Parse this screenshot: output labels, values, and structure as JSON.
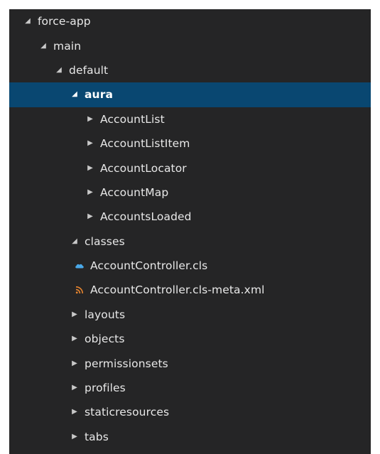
{
  "explorer": {
    "items": [
      {
        "label": "force-app",
        "type": "folder",
        "expanded": true,
        "depth": 0
      },
      {
        "label": "main",
        "type": "folder",
        "expanded": true,
        "depth": 1
      },
      {
        "label": "default",
        "type": "folder",
        "expanded": true,
        "depth": 2
      },
      {
        "label": "aura",
        "type": "folder",
        "expanded": true,
        "depth": 3,
        "selected": true
      },
      {
        "label": "AccountList",
        "type": "folder",
        "expanded": false,
        "depth": 4
      },
      {
        "label": "AccountListItem",
        "type": "folder",
        "expanded": false,
        "depth": 4
      },
      {
        "label": "AccountLocator",
        "type": "folder",
        "expanded": false,
        "depth": 4
      },
      {
        "label": "AccountMap",
        "type": "folder",
        "expanded": false,
        "depth": 4
      },
      {
        "label": "AccountsLoaded",
        "type": "folder",
        "expanded": false,
        "depth": 4
      },
      {
        "label": "classes",
        "type": "folder",
        "expanded": true,
        "depth": 3
      },
      {
        "label": "AccountController.cls",
        "type": "file",
        "icon": "cls-file-icon",
        "depth": 4
      },
      {
        "label": "AccountController.cls-meta.xml",
        "type": "file",
        "icon": "xml-file-icon",
        "depth": 4
      },
      {
        "label": "layouts",
        "type": "folder",
        "expanded": false,
        "depth": 3
      },
      {
        "label": "objects",
        "type": "folder",
        "expanded": false,
        "depth": 3
      },
      {
        "label": "permissionsets",
        "type": "folder",
        "expanded": false,
        "depth": 3
      },
      {
        "label": "profiles",
        "type": "folder",
        "expanded": false,
        "depth": 3
      },
      {
        "label": "staticresources",
        "type": "folder",
        "expanded": false,
        "depth": 3
      },
      {
        "label": "tabs",
        "type": "folder",
        "expanded": false,
        "depth": 3
      }
    ]
  },
  "colors": {
    "panel_background": "#252526",
    "selection": "#094771",
    "text": "#e8e8e8",
    "cls_icon": "#4aa8e8",
    "xml_icon": "#e8852f"
  },
  "icons": {
    "expanded": "chevron-down-icon",
    "collapsed": "chevron-right-icon"
  }
}
